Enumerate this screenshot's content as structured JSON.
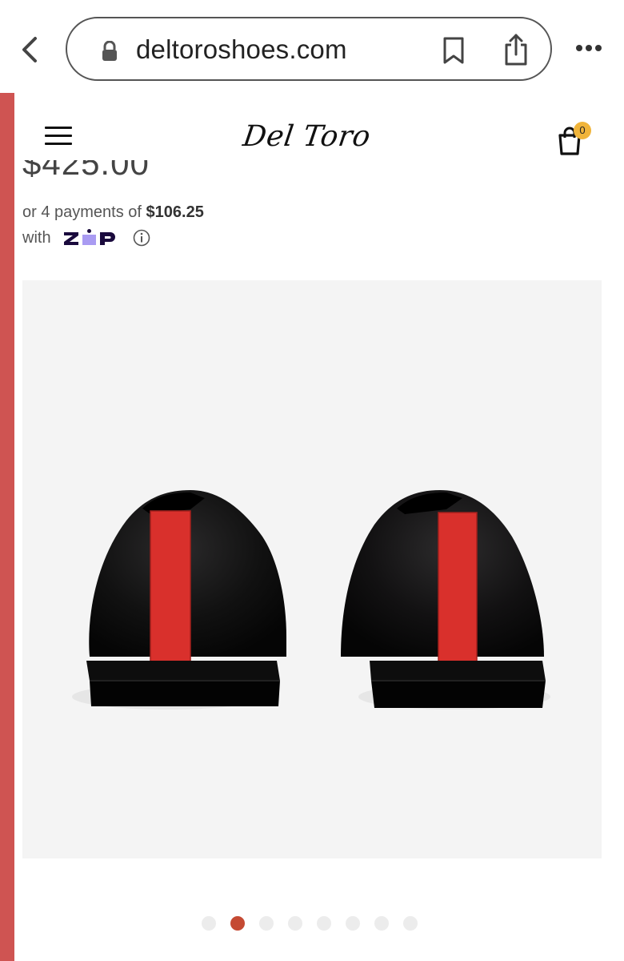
{
  "browser": {
    "url": "deltoroshoes.com",
    "icons": [
      "chevron-left-icon",
      "lock-icon",
      "bookmark-icon",
      "share-icon",
      "more-icon"
    ]
  },
  "header": {
    "logo": "Del Toro",
    "cart_count": "0",
    "icons": [
      "menu-icon",
      "shopping-bag-icon"
    ]
  },
  "product": {
    "price": "$425.00",
    "installments_prefix": "or 4 payments of ",
    "installment_amount": "$106.25",
    "with_label": "with",
    "zip_brand": "ZIP"
  },
  "gallery": {
    "image_subject": "black velvet loafers rear view with red grosgrain heel tab",
    "slide_count": 8,
    "active_slide": 2
  },
  "colors": {
    "accent_red": "#cf5452",
    "active_dot": "#c54a33",
    "cart_badge": "#f0b43a",
    "zip_purple": "#a99bf2",
    "zip_dark": "#1a0a3d"
  }
}
